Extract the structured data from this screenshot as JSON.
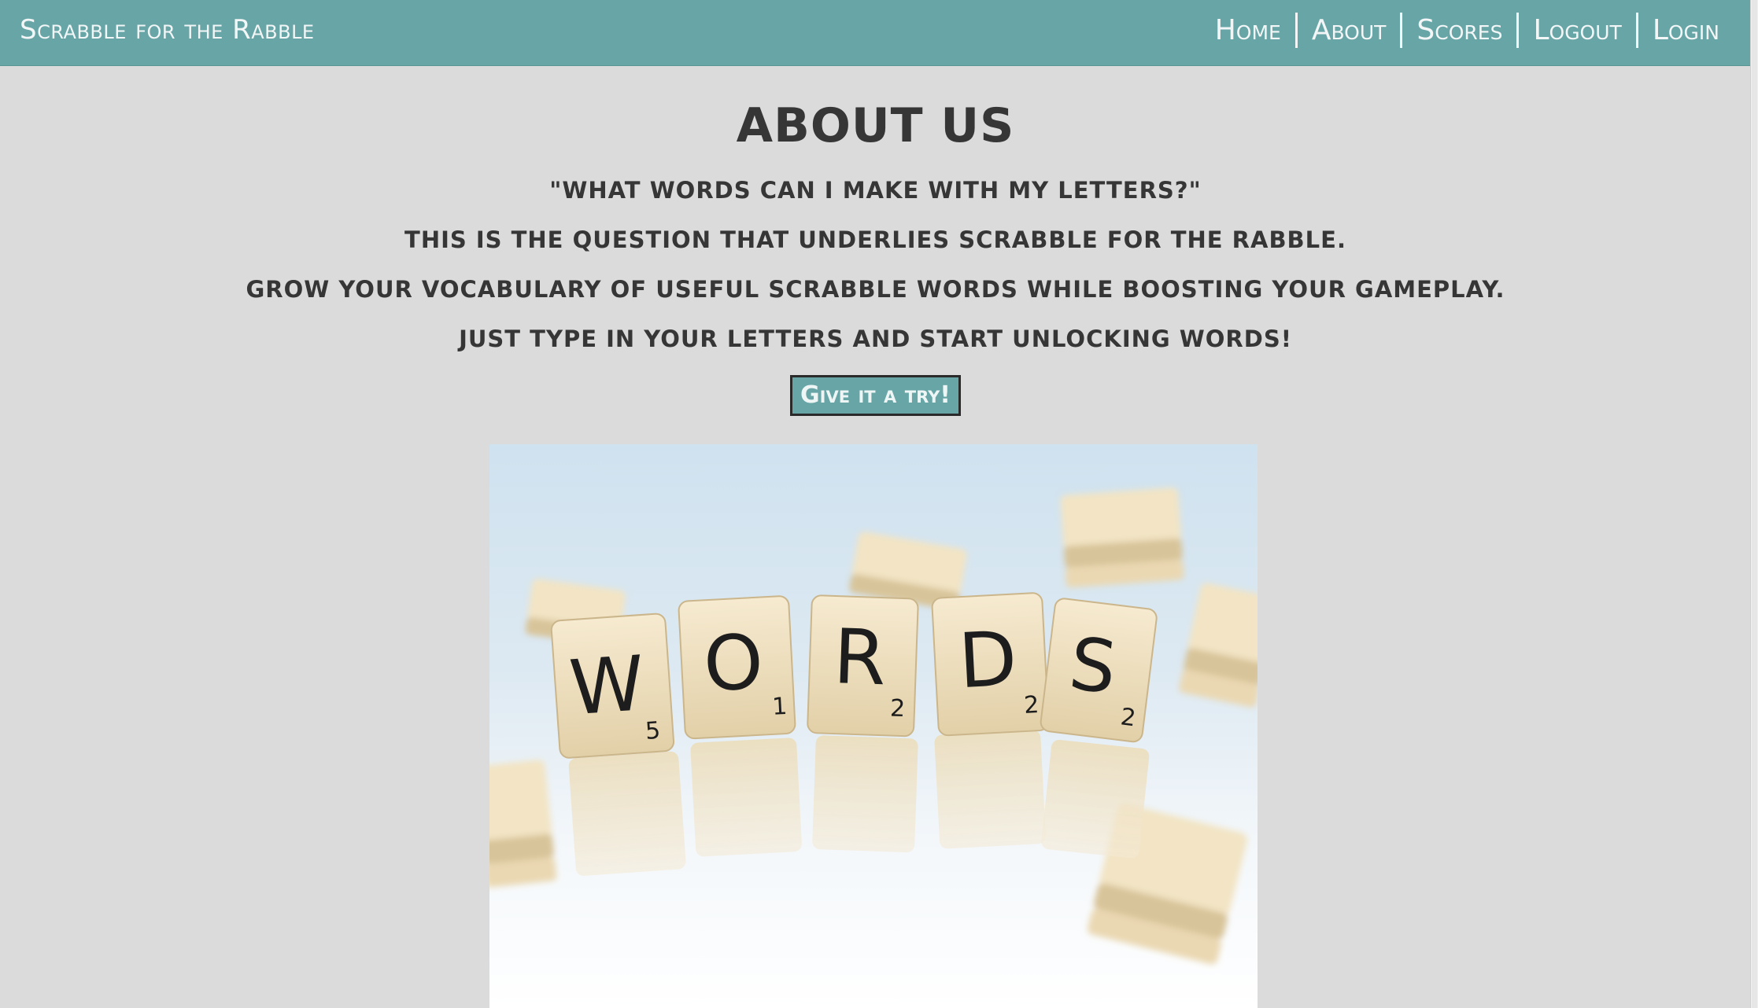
{
  "navbar": {
    "brand": "Scrabble for the Rabble",
    "items": [
      {
        "label": "Home"
      },
      {
        "label": "About"
      },
      {
        "label": "Scores"
      },
      {
        "label": "Logout"
      },
      {
        "label": "Login"
      }
    ]
  },
  "main": {
    "title": "ABOUT US",
    "lines": [
      "\"What words can I make with my letters?\"",
      "This is the question that underlies Scrabble for the Rabble.",
      "Grow your vocabulary of useful scrabble words while boosting your gameplay.",
      "Just type in your letters and start unlocking words!"
    ],
    "cta_label": "Give it a try!"
  },
  "hero": {
    "tiles": [
      {
        "letter": "W",
        "points": "5"
      },
      {
        "letter": "O",
        "points": "1"
      },
      {
        "letter": "R",
        "points": "2"
      },
      {
        "letter": "D",
        "points": "2"
      },
      {
        "letter": "S",
        "points": "2"
      }
    ]
  },
  "colors": {
    "navbar": "#67a5a6",
    "background": "#dbdbdb",
    "text": "#363636",
    "tile": "#f0e2c2"
  }
}
